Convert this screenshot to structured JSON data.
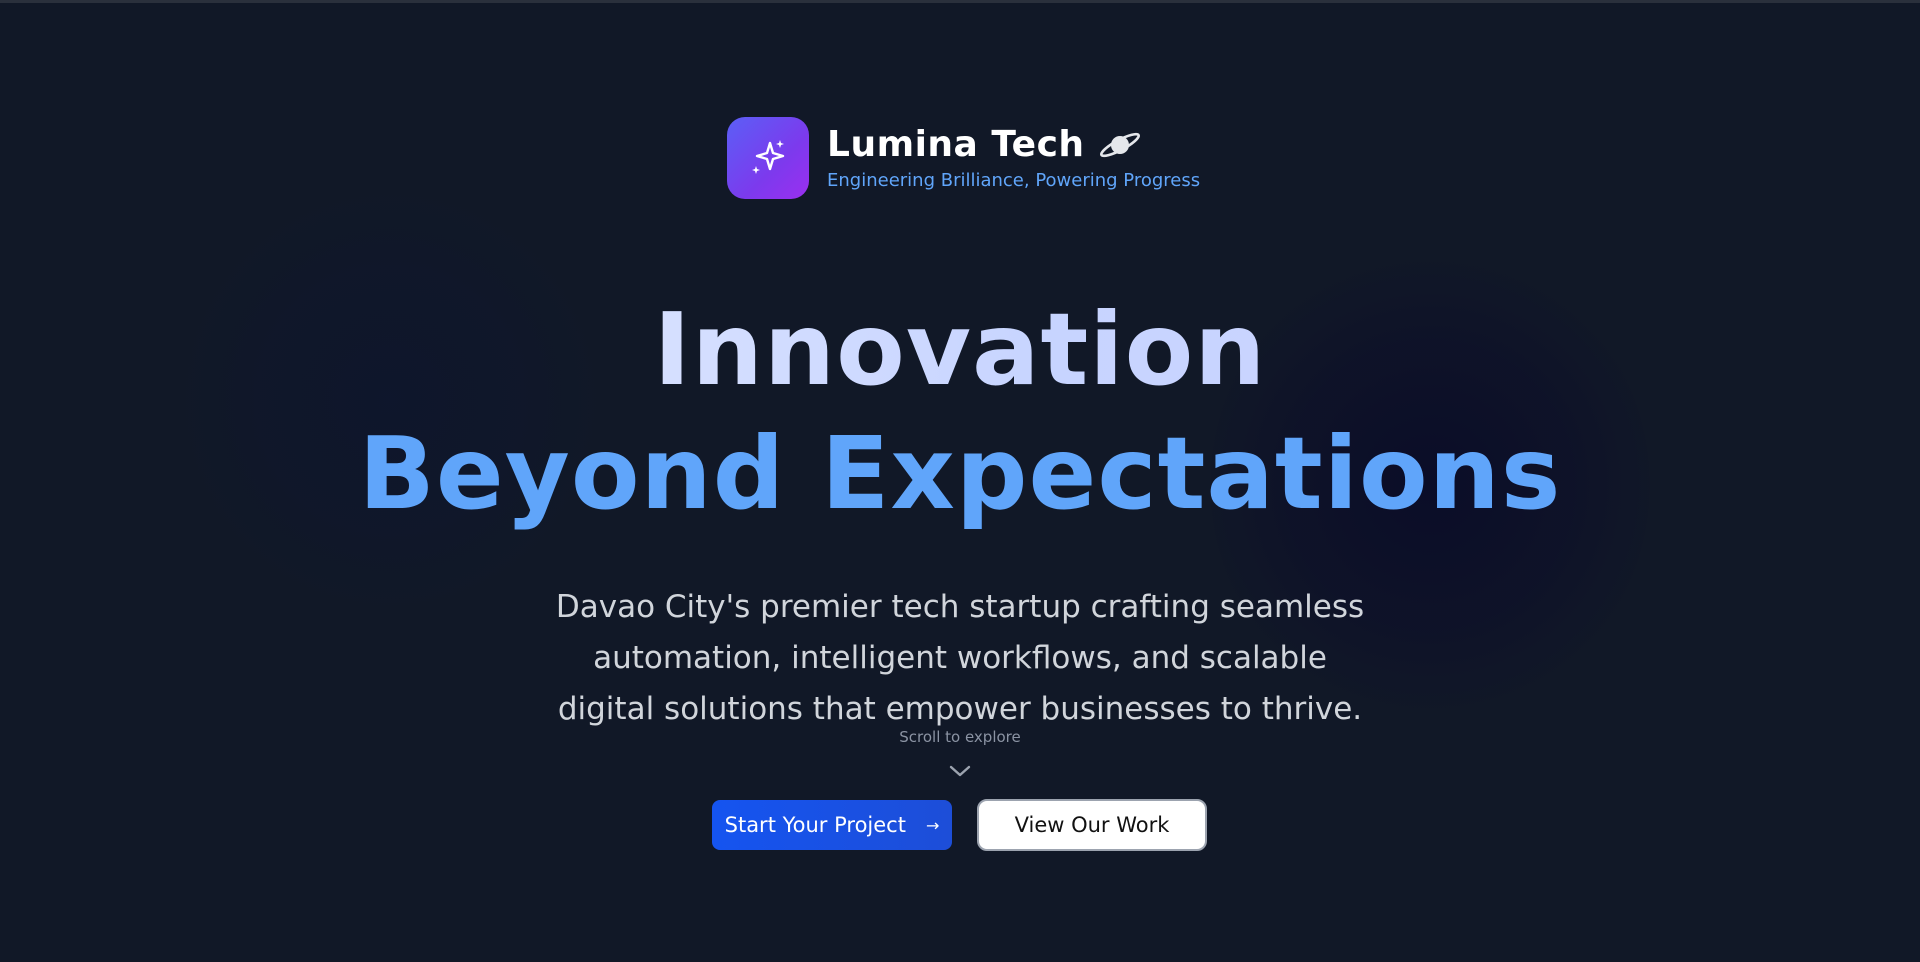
{
  "brand": {
    "name": "Lumina Tech",
    "tagline": "Engineering Brilliance, Powering Progress",
    "logo_icon": "sparkles-icon",
    "name_icon": "planet-icon"
  },
  "hero": {
    "headline_line1": "Innovation",
    "headline_line2": "Beyond Expectations",
    "subtitle": "Davao City's premier tech startup crafting seamless automation, intelligent workflows, and scalable digital solutions that empower businesses to thrive.",
    "scroll_hint": "Scroll to explore"
  },
  "actions": {
    "primary_label": "Start Your Project",
    "primary_icon": "arrow-right-icon",
    "secondary_label": "View Our Work"
  },
  "colors": {
    "background": "#111827",
    "accent_blue": "#60a5fa",
    "primary_button": "#1d4ed8",
    "logo_gradient_start": "#5b5ff6",
    "logo_gradient_end": "#9b2ff0"
  }
}
